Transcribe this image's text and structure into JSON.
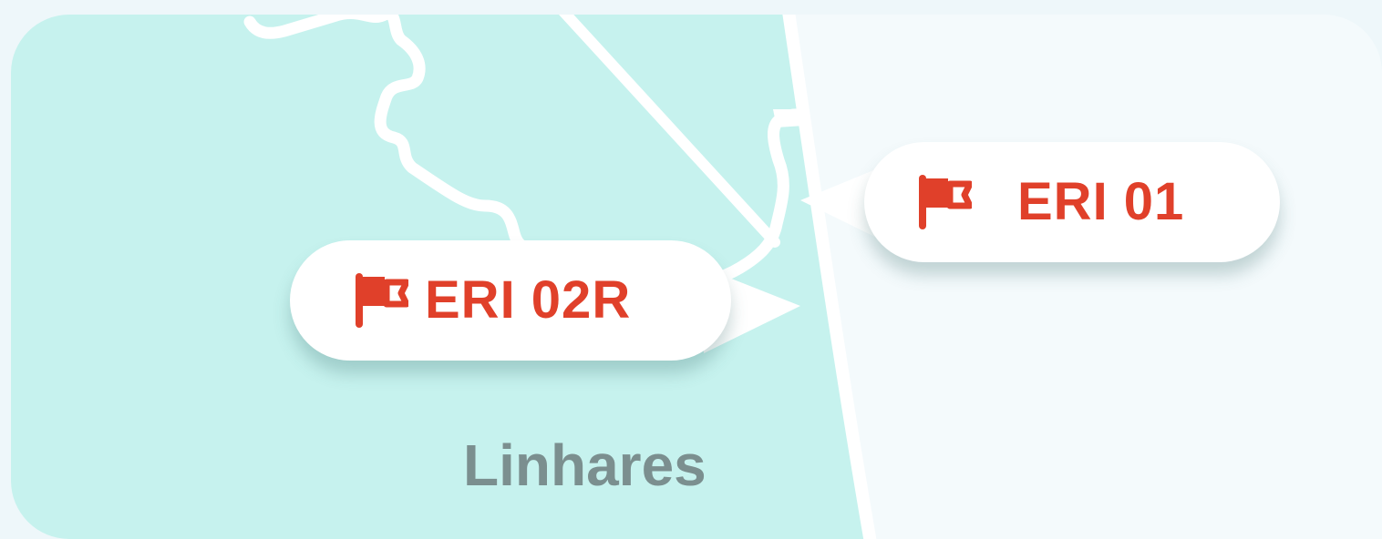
{
  "map": {
    "region_fill_color": "#c6f2ee",
    "outside_fill_color": "#f4fafc",
    "boundary_color": "#ffffff",
    "place_label": "Linhares"
  },
  "markers": [
    {
      "id": "eri-02r",
      "label": "ERI 02R",
      "icon": "flag-icon",
      "color": "#e0402a"
    },
    {
      "id": "eri-01",
      "label": "ERI 01",
      "icon": "flag-icon",
      "color": "#e0402a"
    }
  ]
}
